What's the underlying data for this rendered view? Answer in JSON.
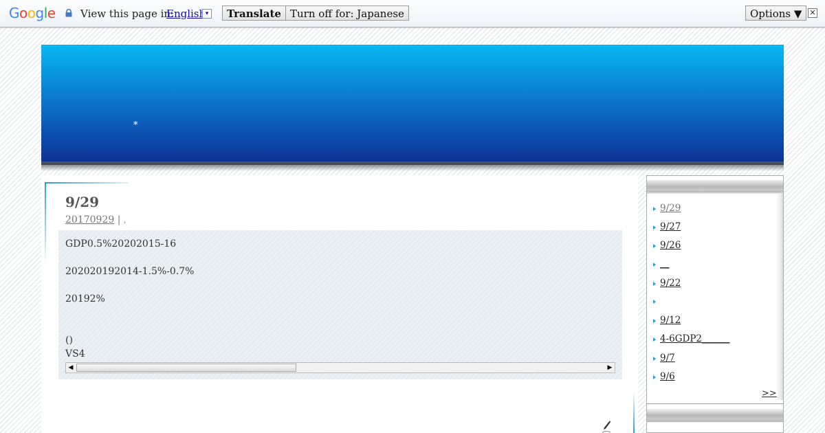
{
  "translate_bar": {
    "logo_text": "Google",
    "view_label": "View this page in:",
    "language": "English",
    "dropdown_glyph": "▾",
    "translate_button": "Translate",
    "turn_off_button": "Turn off for: Japanese",
    "options_button": "Options ▼",
    "close_glyph": "✕"
  },
  "banner": {
    "star": "*"
  },
  "post": {
    "title": "9/29",
    "date_link": "20170929",
    "meta_sep": " | ",
    "meta_extra": ",",
    "paragraphs": [
      "GDP0.5%20202015-16",
      "202020192014-1.5%-0.7%",
      "20192%",
      "()",
      "VS4"
    ]
  },
  "scrollbar": {
    "left_arrow": "◀",
    "right_arrow": "▶"
  },
  "sidebar": {
    "items": [
      "9/29",
      "9/27",
      "9/26",
      "__",
      "9/22",
      "",
      "9/12",
      "4-6GDP2______",
      "9/7",
      "9/6"
    ],
    "more_link": ">>"
  },
  "colors": {
    "banner_top": "#08b8f2",
    "banner_bottom": "#0f2e92",
    "accent": "#2a9ccf",
    "link": "#1a0dab"
  }
}
